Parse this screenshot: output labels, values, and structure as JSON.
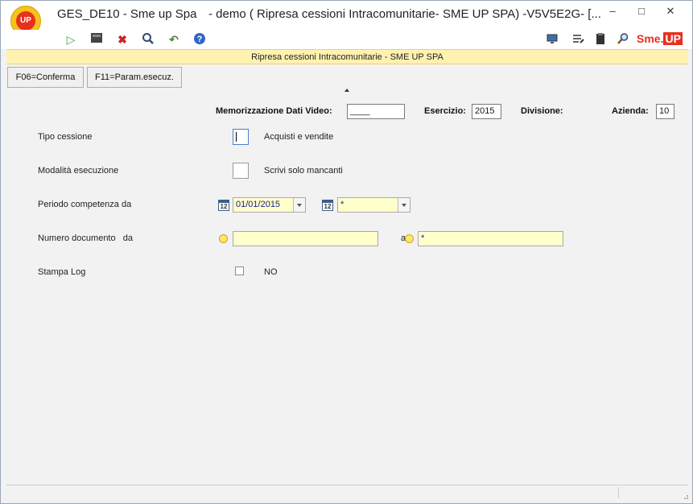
{
  "window": {
    "app_name": "GES_DE10 - Sme up Spa",
    "title_rest": "- demo ( Ripresa cessioni Intracomunitarie- SME UP SPA) -V5V5E2G- [...",
    "logo_text": "UP"
  },
  "toolbar": {
    "right_brand": "Sme.",
    "right_brand_badge": "UP"
  },
  "header": {
    "title": "Ripresa cessioni Intracomunitarie -  SME UP SPA"
  },
  "function_keys": [
    {
      "label": "F06=Conferma"
    },
    {
      "label": "F11=Param.esecuz."
    }
  ],
  "top_fields": {
    "memorizzazione_label": "Memorizzazione Dati Video:",
    "memorizzazione_value": "____",
    "esercizio_label": "Esercizio:",
    "esercizio_value": "2015",
    "divisione_label": "Divisione:",
    "azienda_label": "Azienda:",
    "azienda_value": "10"
  },
  "form": {
    "tipo_cessione": {
      "label": "Tipo cessione",
      "value": "",
      "description": "Acquisti e vendite"
    },
    "modalita_esecuzione": {
      "label": "Modalità esecuzione",
      "value": "",
      "description": "Scrivi solo mancanti"
    },
    "periodo_competenza": {
      "label": "Periodo competenza da",
      "from": "01/01/2015",
      "to": "*",
      "cal_text": "12"
    },
    "numero_documento": {
      "label": "Numero documento   da",
      "from": "",
      "a_label": "a",
      "to": "*"
    },
    "stampa_log": {
      "label": "Stampa Log",
      "value": "NO"
    }
  },
  "colors": {
    "header_band": "#fff2b0",
    "field_yellow": "#ffffcc",
    "accent_red": "#e8301e",
    "logo_yellow": "#f6c21c"
  }
}
